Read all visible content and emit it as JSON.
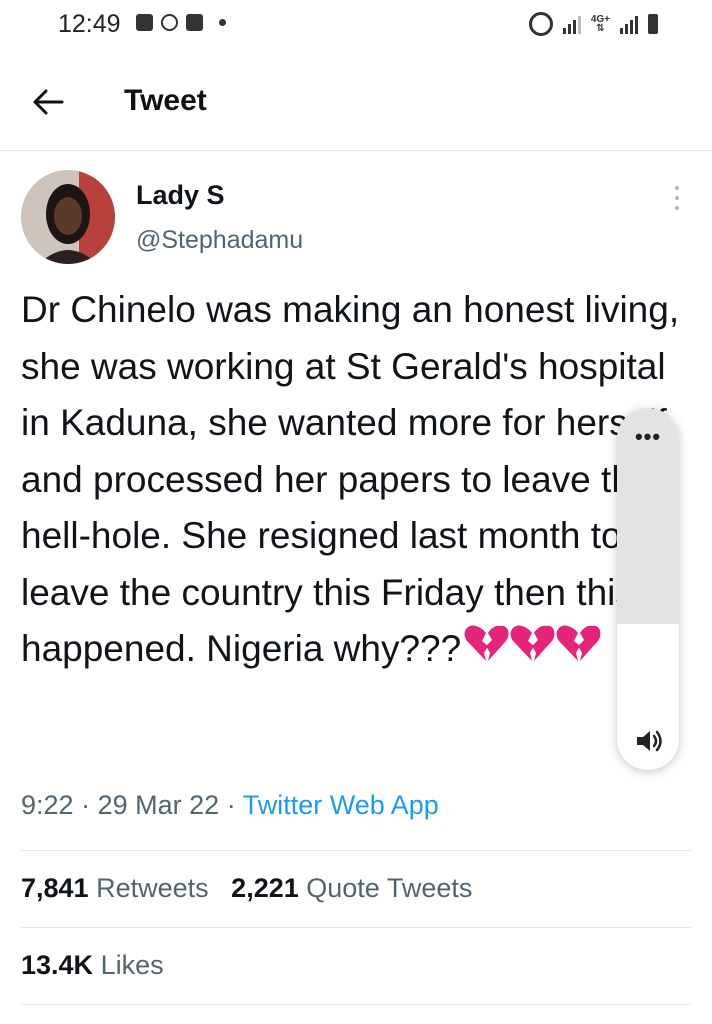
{
  "status_bar": {
    "time": "12:49",
    "network_label_top": "4G+",
    "network_label_bottom": "⇅",
    "icons": [
      "square-notification-icon",
      "whatsapp-icon",
      "facebook-icon",
      "dot-icon",
      "hotspot-icon",
      "signal-icon",
      "signal-icon",
      "battery-icon"
    ]
  },
  "header": {
    "title": "Tweet",
    "back_icon": "arrow-left-icon"
  },
  "tweet": {
    "author_name": "Lady S",
    "author_handle": "@Stephadamu",
    "text": "Dr Chinelo was making an honest living, she was working at St Gerald's hospital in Kaduna, she wanted more for herself and processed her papers to leave this hell-hole. She resigned last month to leave the country this Friday then this happened. Nigeria why???",
    "emoji": "💔💔💔",
    "heart_color": "#e5257a",
    "time": "9:22",
    "date": "29 Mar 22",
    "separator": "·",
    "source": "Twitter Web App",
    "source_color": "#1d9bf0"
  },
  "stats": {
    "retweets_count": "7,841",
    "retweets_label": "Retweets",
    "quotes_count": "2,221",
    "quotes_label": "Quote Tweets",
    "likes_count": "13.4K",
    "likes_label": "Likes"
  },
  "volume_panel": {
    "more_label": "•••",
    "speaker_icon": "speaker-icon",
    "level": 0.6
  }
}
